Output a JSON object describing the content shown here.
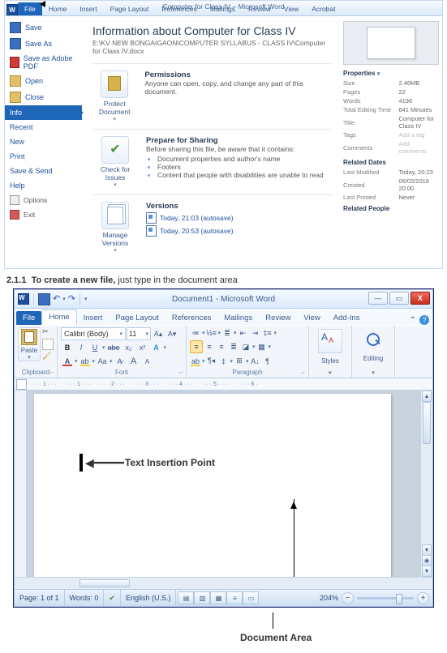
{
  "fig1": {
    "titlebar": "Computer for Class IV – Microsoft Word",
    "tabs": [
      "File",
      "Home",
      "Insert",
      "Page Layout",
      "References",
      "Mailings",
      "Review",
      "View",
      "Acrobat"
    ],
    "sidemenu": {
      "save": "Save",
      "saveas": "Save As",
      "pdf": "Save as Adobe PDF",
      "open": "Open",
      "close": "Close",
      "info": "Info",
      "recent": "Recent",
      "new": "New",
      "print": "Print",
      "savesend": "Save & Send",
      "help": "Help",
      "options": "Options",
      "exit": "Exit"
    },
    "center": {
      "title": "Information about Computer for Class IV",
      "path": "E:\\KV NEW BONGAIGAON\\COMPUTER SYLLABUS - CLASS IV\\Computer for Class IV.docx",
      "protect_btn": "Protect Document",
      "perm_h": "Permissions",
      "perm_d": "Anyone can open, copy, and change any part of this document.",
      "check_btn": "Check for Issues",
      "prep_h": "Prepare for Sharing",
      "prep_d": "Before sharing this file, be aware that it contains:",
      "prep_items": [
        "Document properties and author's name",
        "Footers",
        "Content that people with disabilities are unable to read"
      ],
      "ver_btn": "Manage Versions",
      "ver_h": "Versions",
      "ver_items": [
        "Today, 21:03 (autosave)",
        "Today, 20:53 (autosave)"
      ]
    },
    "right": {
      "props_h": "Properties",
      "rows": [
        {
          "k": "Size",
          "v": "2.46MB"
        },
        {
          "k": "Pages",
          "v": "22"
        },
        {
          "k": "Words",
          "v": "4196"
        },
        {
          "k": "Total Editing Time",
          "v": "641 Minutes"
        },
        {
          "k": "Title",
          "v": "Computer for Class IV"
        },
        {
          "k": "Tags",
          "v": "Add a tag",
          "ph": true
        },
        {
          "k": "Comments",
          "v": "Add comments",
          "ph": true
        }
      ],
      "dates_h": "Related Dates",
      "dates": [
        {
          "k": "Last Modified",
          "v": "Today, 20:23"
        },
        {
          "k": "Created",
          "v": "06/03/2016 20:00"
        },
        {
          "k": "Last Printed",
          "v": "Never"
        }
      ],
      "people_h": "Related People"
    }
  },
  "caption": {
    "num": "2.1.1",
    "bold": "To create a new file,",
    "rest": " just type in the document area"
  },
  "fig2": {
    "title": "Document1 - Microsoft Word",
    "tabs": [
      "File",
      "Home",
      "Insert",
      "Page Layout",
      "References",
      "Mailings",
      "Review",
      "View",
      "Add-Ins"
    ],
    "font": {
      "name": "Calibri (Body)",
      "size": "11"
    },
    "groups": {
      "clipboard": "Clipboard",
      "font": "Font",
      "paragraph": "Paragraph",
      "styles": "Styles",
      "editing": "Editing"
    },
    "paste": "Paste",
    "insertion": "Text Insertion Point",
    "status": {
      "page": "Page: 1 of 1",
      "words": "Words: 0",
      "lang": "English (U.S.)",
      "zoom": "204%"
    },
    "doc_area": "Document Area"
  }
}
